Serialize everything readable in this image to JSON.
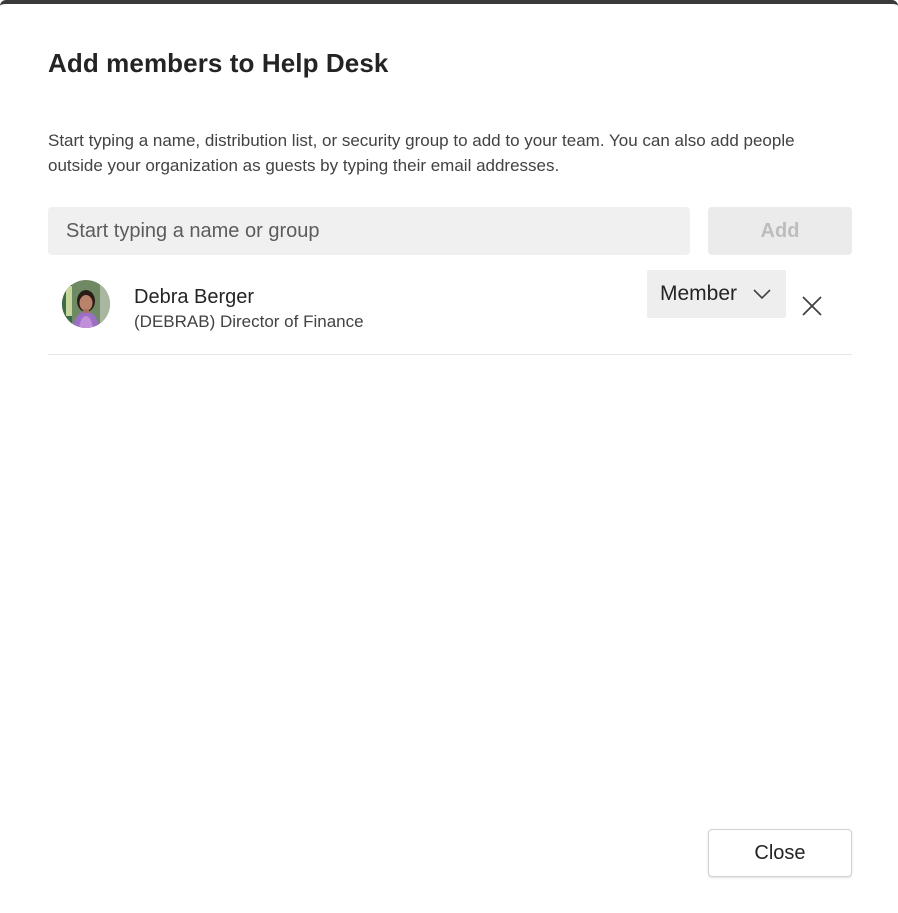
{
  "dialog": {
    "title": "Add members to Help Desk",
    "description": "Start typing a name, distribution list, or security group to add to your team. You can also add people outside your organization as guests by typing their email addresses."
  },
  "search": {
    "placeholder": "Start typing a name or group",
    "value": ""
  },
  "add_button": {
    "label": "Add",
    "disabled": true
  },
  "members": [
    {
      "name": "Debra Berger",
      "subtitle": "(DEBRAB) Director of Finance",
      "role": "Member",
      "avatar_icon": "person-photo"
    }
  ],
  "icons": {
    "role_dropdown": "chevron-down-icon",
    "remove_member": "close-icon"
  },
  "close_button": {
    "label": "Close"
  },
  "colors": {
    "input_background": "#f0f0f0",
    "disabled_text": "#bdbdbd",
    "text_primary": "#242424"
  }
}
